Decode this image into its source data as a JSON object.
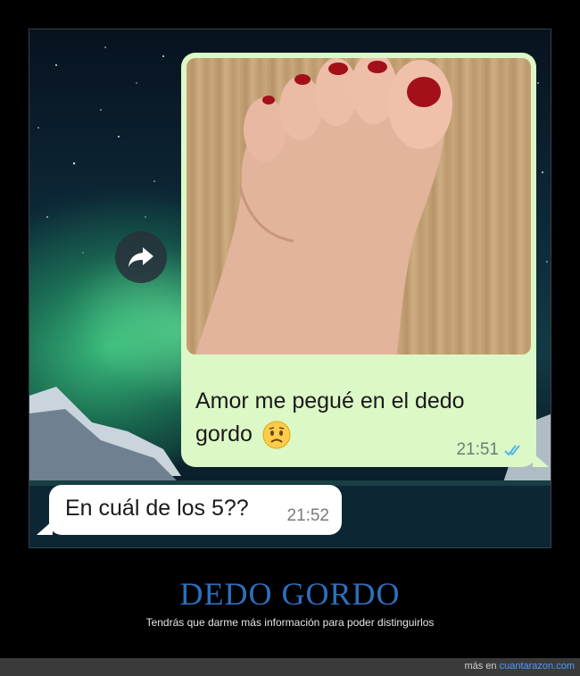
{
  "chat": {
    "outgoing": {
      "message": "Amor me pegué en el dedo gordo",
      "time": "21:51",
      "status_icon": "double-check-read-icon",
      "emoji": "worried-face-emoji"
    },
    "incoming": {
      "message": "En cuál de los 5??",
      "time": "21:52"
    },
    "forward_icon": "forward-arrow-icon"
  },
  "caption": {
    "title": "DEDO GORDO",
    "subtitle": "Tendrás que darme más información para poder distinguirlos"
  },
  "footer": {
    "prefix": "más en",
    "site": "cuantarazon.com"
  },
  "colors": {
    "outgoing_bubble": "#dcf8c6",
    "incoming_bubble": "#ffffff",
    "caption_title": "#2c6fbd",
    "read_ticks": "#4fb6ec",
    "nail_polish": "#a3101a"
  }
}
